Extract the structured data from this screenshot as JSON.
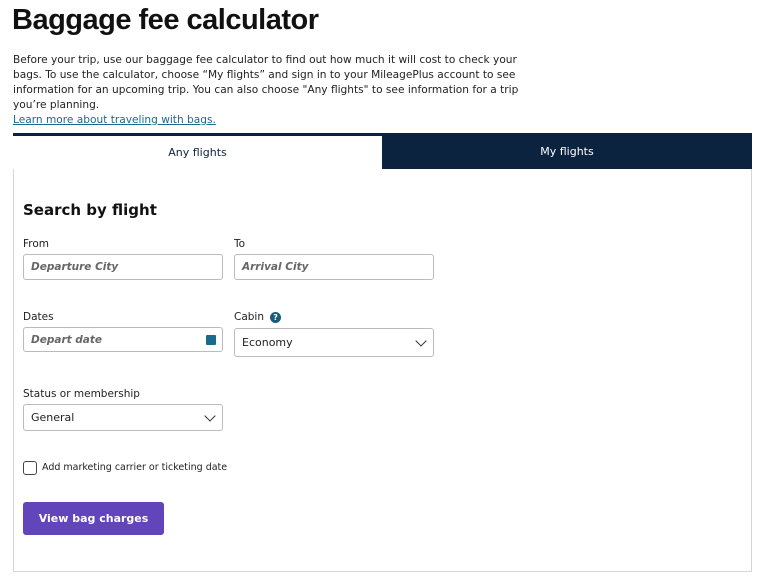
{
  "title": "Baggage fee calculator",
  "intro": "Before your trip, use our baggage fee calculator to find out how much it will cost to check your bags. To use the calculator, choose “My flights” and sign in to your MileagePlus account to see information for an upcoming trip. You can also choose \"Any flights\" to see information for a trip you’re planning.",
  "learn_more": "Learn more about traveling with bags.",
  "tabs": [
    {
      "label": "Any flights",
      "active": true
    },
    {
      "label": "My flights",
      "active": false
    }
  ],
  "form": {
    "heading": "Search by flight",
    "from_label": "From",
    "from_placeholder": "Departure City",
    "to_label": "To",
    "to_placeholder": "Arrival City",
    "dates_label": "Dates",
    "dates_placeholder": "Depart date",
    "cabin_label": "Cabin",
    "cabin_help": "?",
    "cabin_value": "Economy",
    "status_label": "Status or membership",
    "status_value": "General",
    "checkbox_label": "Add marketing carrier or ticketing date",
    "checkbox_checked": false,
    "submit": "View bag charges"
  },
  "colors": {
    "navy": "#0c2340",
    "button": "#6244bb",
    "link": "#1a6a8c"
  }
}
